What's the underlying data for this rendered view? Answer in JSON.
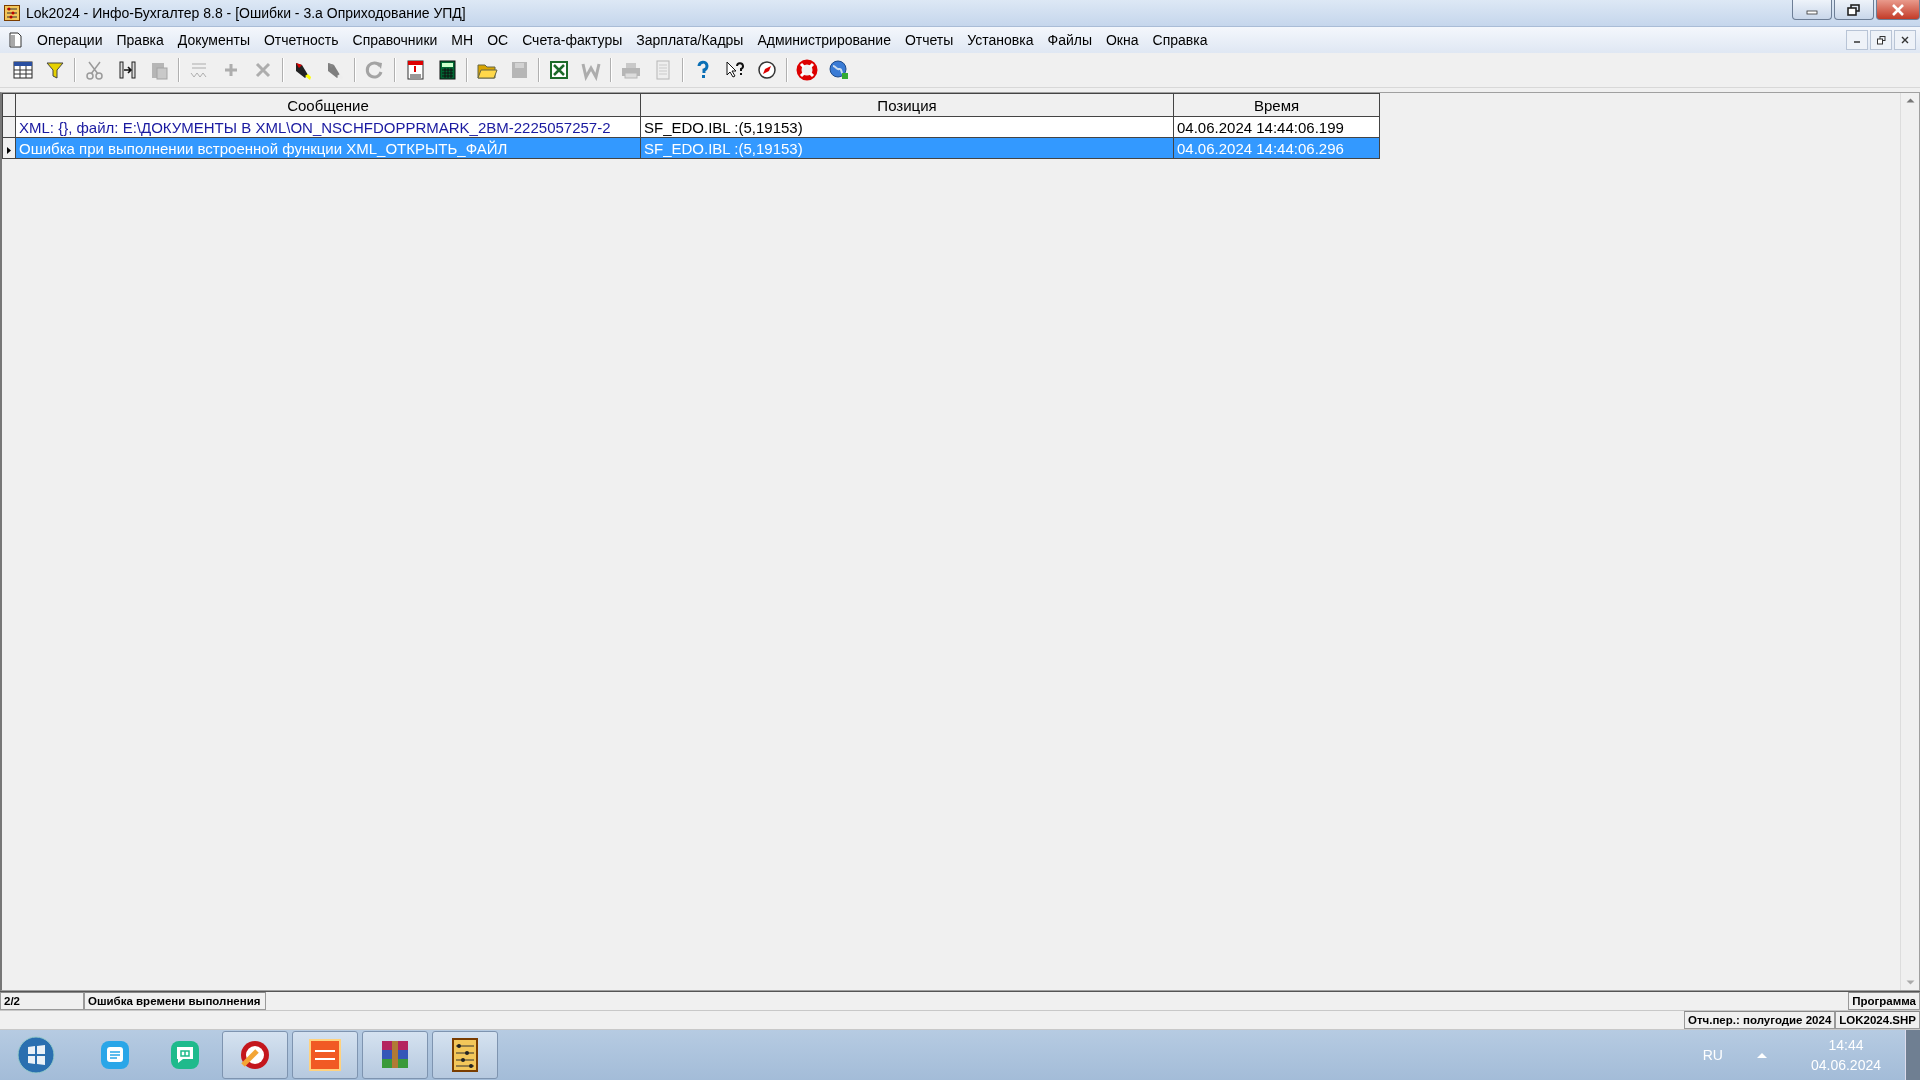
{
  "window": {
    "title": "Lok2024 - Инфо-Бухгалтер 8.8 - [Ошибки -   3.а Оприходование УПД]"
  },
  "menu": [
    "Операции",
    "Правка",
    "Документы",
    "Отчетность",
    "Справочники",
    "МН",
    "ОС",
    "Счета-фактуры",
    "Зарплата/Кадры",
    "Администрирование",
    "Отчеты",
    "Установка",
    "Файлы",
    "Окна",
    "Справка"
  ],
  "toolbar": [
    {
      "kind": "table",
      "disabled": false
    },
    {
      "kind": "filter",
      "disabled": false
    },
    {
      "kind": "separator"
    },
    {
      "kind": "scissors",
      "disabled": true
    },
    {
      "kind": "columns",
      "disabled": false
    },
    {
      "kind": "paste",
      "disabled": true
    },
    {
      "kind": "separator"
    },
    {
      "kind": "numbering",
      "disabled": true
    },
    {
      "kind": "plus",
      "disabled": true
    },
    {
      "kind": "cross",
      "disabled": true
    },
    {
      "kind": "separator"
    },
    {
      "kind": "flashlight",
      "disabled": false
    },
    {
      "kind": "flashlight",
      "disabled": true
    },
    {
      "kind": "separator"
    },
    {
      "kind": "refresh",
      "disabled": true
    },
    {
      "kind": "separator"
    },
    {
      "kind": "calendar",
      "disabled": false
    },
    {
      "kind": "calculator",
      "disabled": false
    },
    {
      "kind": "separator"
    },
    {
      "kind": "folder",
      "disabled": false
    },
    {
      "kind": "save",
      "disabled": true
    },
    {
      "kind": "separator"
    },
    {
      "kind": "spreadsheet",
      "disabled": false
    },
    {
      "kind": "wordfile",
      "disabled": true
    },
    {
      "kind": "separator"
    },
    {
      "kind": "printer",
      "disabled": true
    },
    {
      "kind": "page",
      "disabled": true
    },
    {
      "kind": "separator"
    },
    {
      "kind": "help",
      "disabled": false
    },
    {
      "kind": "pointerhelp",
      "disabled": false
    },
    {
      "kind": "compass",
      "disabled": false
    },
    {
      "kind": "separator"
    },
    {
      "kind": "lifebuoy",
      "disabled": false
    },
    {
      "kind": "globe",
      "disabled": false
    }
  ],
  "table": {
    "columns": [
      "Сообщение",
      "Позиция",
      "Время"
    ],
    "rows": [
      {
        "selected": false,
        "cells": [
          "XML: {}, файл: E:\\ДОКУМЕНТЫ В XML\\ON_NSCHFDOPPRMARK_2BM-2225057257-2",
          "SF_EDO.IBL :(5,19153)",
          "04.06.2024 14:44:06.199"
        ]
      },
      {
        "selected": true,
        "cells": [
          "Ошибка при выполнении встроенной функции XML_ОТКРЫТЬ_ФАЙЛ",
          "SF_EDO.IBL :(5,19153)",
          "04.06.2024 14:44:06.296"
        ]
      }
    ]
  },
  "status_bar": {
    "count": "2/2",
    "message": "Ошибка времени выполнения",
    "source": "Программа"
  },
  "info_bar": {
    "period": "Отч.пер.: полугодие 2024",
    "file": "LOK2024.SHP"
  },
  "taskbar": {
    "apps": [
      {
        "kind": "notes",
        "running": false
      },
      {
        "kind": "chat",
        "running": false
      },
      {
        "kind": "cleaner",
        "running": true
      },
      {
        "kind": "tile",
        "running": true
      },
      {
        "kind": "archive",
        "running": true
      },
      {
        "kind": "abacus",
        "running": true
      }
    ],
    "language": "RU",
    "time": "14:44",
    "date": "04.06.2024"
  }
}
